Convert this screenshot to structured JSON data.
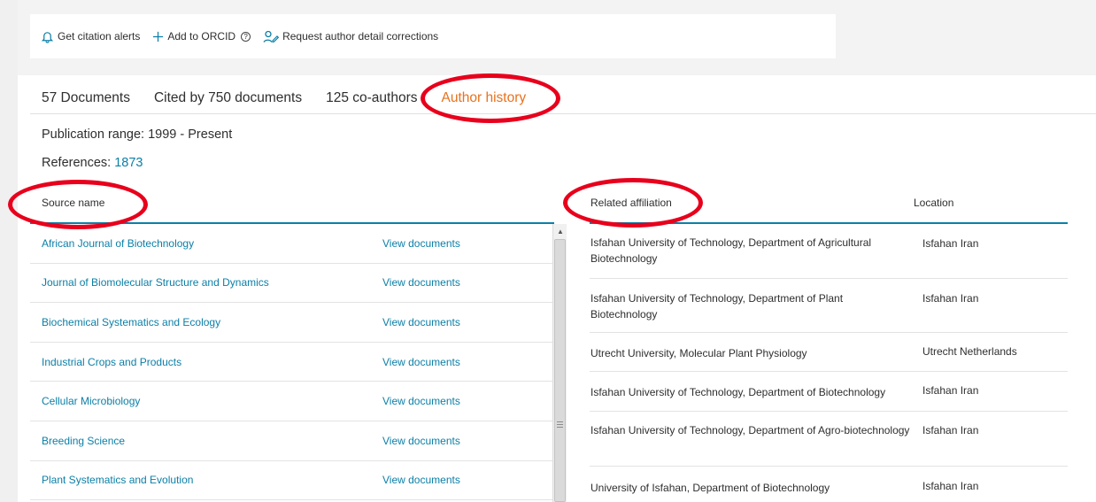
{
  "actions": [
    {
      "label": "Get citation alerts",
      "icon": "bell-icon"
    },
    {
      "label": "Add to ORCID",
      "icon": "plus-icon",
      "help": "?"
    },
    {
      "label": "Request author detail corrections",
      "icon": "edit-user-icon"
    }
  ],
  "tabs": [
    {
      "label": "57 Documents"
    },
    {
      "label": "Cited by 750 documents"
    },
    {
      "label": "125 co-authors"
    },
    {
      "label": "Author history",
      "active": true
    }
  ],
  "publication_range": "Publication range: 1999 - Present",
  "references_label": "References:",
  "references_count": "1873",
  "sources": {
    "header": "Source name",
    "view_label": "View documents",
    "rows": [
      "African Journal of Biotechnology",
      "Journal of Biomolecular Structure and Dynamics",
      "Biochemical Systematics and Ecology",
      "Industrial Crops and Products",
      "Cellular Microbiology",
      "Breeding Science",
      "Plant Systematics and Evolution"
    ]
  },
  "affiliations": {
    "header_affiliation": "Related affiliation",
    "header_location": "Location",
    "rows": [
      {
        "name": "Isfahan University of Technology, Department of Agricultural Biotechnology",
        "location": "Isfahan Iran"
      },
      {
        "name": "Isfahan University of Technology, Department of Plant Biotechnology",
        "location": "Isfahan Iran"
      },
      {
        "name": "Utrecht University, Molecular Plant Physiology",
        "location": "Utrecht Netherlands"
      },
      {
        "name": "Isfahan University of Technology, Department of Biotechnology",
        "location": "Isfahan Iran"
      },
      {
        "name": "Isfahan University of Technology, Department of Agro-biotechnology",
        "location": "Isfahan Iran"
      },
      {
        "name": "University of Isfahan, Department of Biotechnology",
        "location": "Isfahan Iran"
      }
    ]
  },
  "colors": {
    "link": "#0b7fa7",
    "active_tab": "#e9711c",
    "annotation": "#e8001c"
  }
}
